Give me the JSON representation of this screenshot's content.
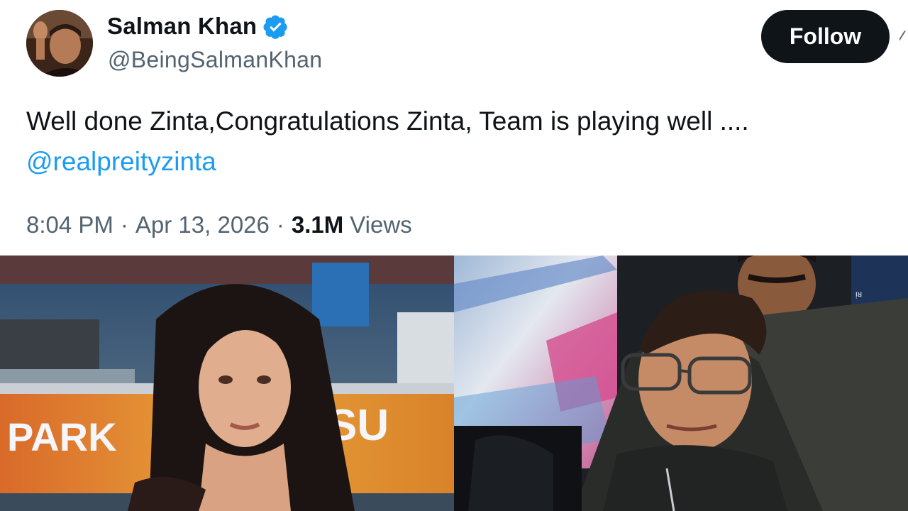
{
  "user": {
    "display_name": "Salman Khan",
    "handle": "@BeingSalmanKhan",
    "verified": true,
    "avatar_icon": "profile-photo-avatar"
  },
  "follow_label": "Follow",
  "tweet": {
    "text": "Well done Zinta,Congratulations Zinta, Team is playing well ....",
    "mention": "@realpreityzinta"
  },
  "meta": {
    "time": "8:04 PM",
    "separator": "·",
    "date": "Apr 13, 2026",
    "views_count": "3.1M",
    "views_label": "Views"
  },
  "photos": {
    "left_sign_text": "PARK",
    "left_sign_text_right": "SU",
    "right_cap_text": "ᴉᴚ"
  },
  "colors": {
    "text": "#0f1419",
    "secondary": "#536471",
    "link": "#1d9bf0",
    "verified": "#1d9bf0",
    "button": "#0f1419"
  }
}
